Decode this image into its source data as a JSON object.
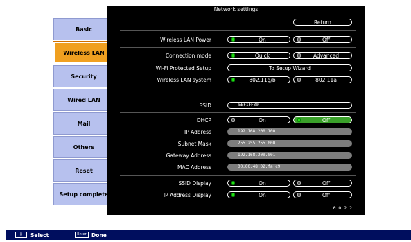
{
  "sidebar": {
    "items": [
      {
        "label": "Basic"
      },
      {
        "label": "Wireless LAN",
        "active": true
      },
      {
        "label": "Security"
      },
      {
        "label": "Wired LAN"
      },
      {
        "label": "Mail"
      },
      {
        "label": "Others"
      },
      {
        "label": "Reset"
      },
      {
        "label": "Setup complete"
      }
    ]
  },
  "panel": {
    "title": "Network settings",
    "return_label": "Return",
    "wireless_lan_power": {
      "label": "Wireless LAN Power",
      "on": "On",
      "off": "Off",
      "selected": "On"
    },
    "connection_mode": {
      "label": "Connection mode",
      "quick": "Quick",
      "advanced": "Advanced",
      "selected": "Quick"
    },
    "wps": {
      "label": "Wi-Fi Protected Setup",
      "button": "To Setup Wizard"
    },
    "wireless_lan_system": {
      "label": "Wireless LAN system",
      "opt1": "802.11g/b",
      "opt2": "802.11a",
      "selected": "802.11g/b"
    },
    "ssid": {
      "label": "SSID",
      "value": "EBF1FF30"
    },
    "dhcp": {
      "label": "DHCP",
      "on": "On",
      "off": "Off",
      "selected": "Off"
    },
    "ip_address": {
      "label": "IP Address",
      "value": "192.168.200.100"
    },
    "subnet_mask": {
      "label": "Subnet Mask",
      "value": "255.255.255.000"
    },
    "gateway_address": {
      "label": "Gateway Address",
      "value": "192.168.200.001"
    },
    "mac_address": {
      "label": "MAC Address",
      "value": "00.00.48.02.fa.c9"
    },
    "ssid_display": {
      "label": "SSID Display",
      "on": "On",
      "off": "Off",
      "selected": "On"
    },
    "ip_display": {
      "label": "IP Address Display",
      "on": "On",
      "off": "Off",
      "selected": "On"
    },
    "version": "0.0.2.2"
  },
  "footer": {
    "select_key": "↕",
    "select_label": "Select",
    "enter_key": "Enter",
    "done_label": "Done"
  },
  "colors": {
    "accent": "#f0a020",
    "sidebar": "#b7c1ee",
    "panel": "#000000",
    "radio_on": "#22e012",
    "footer": "#000e5e"
  }
}
